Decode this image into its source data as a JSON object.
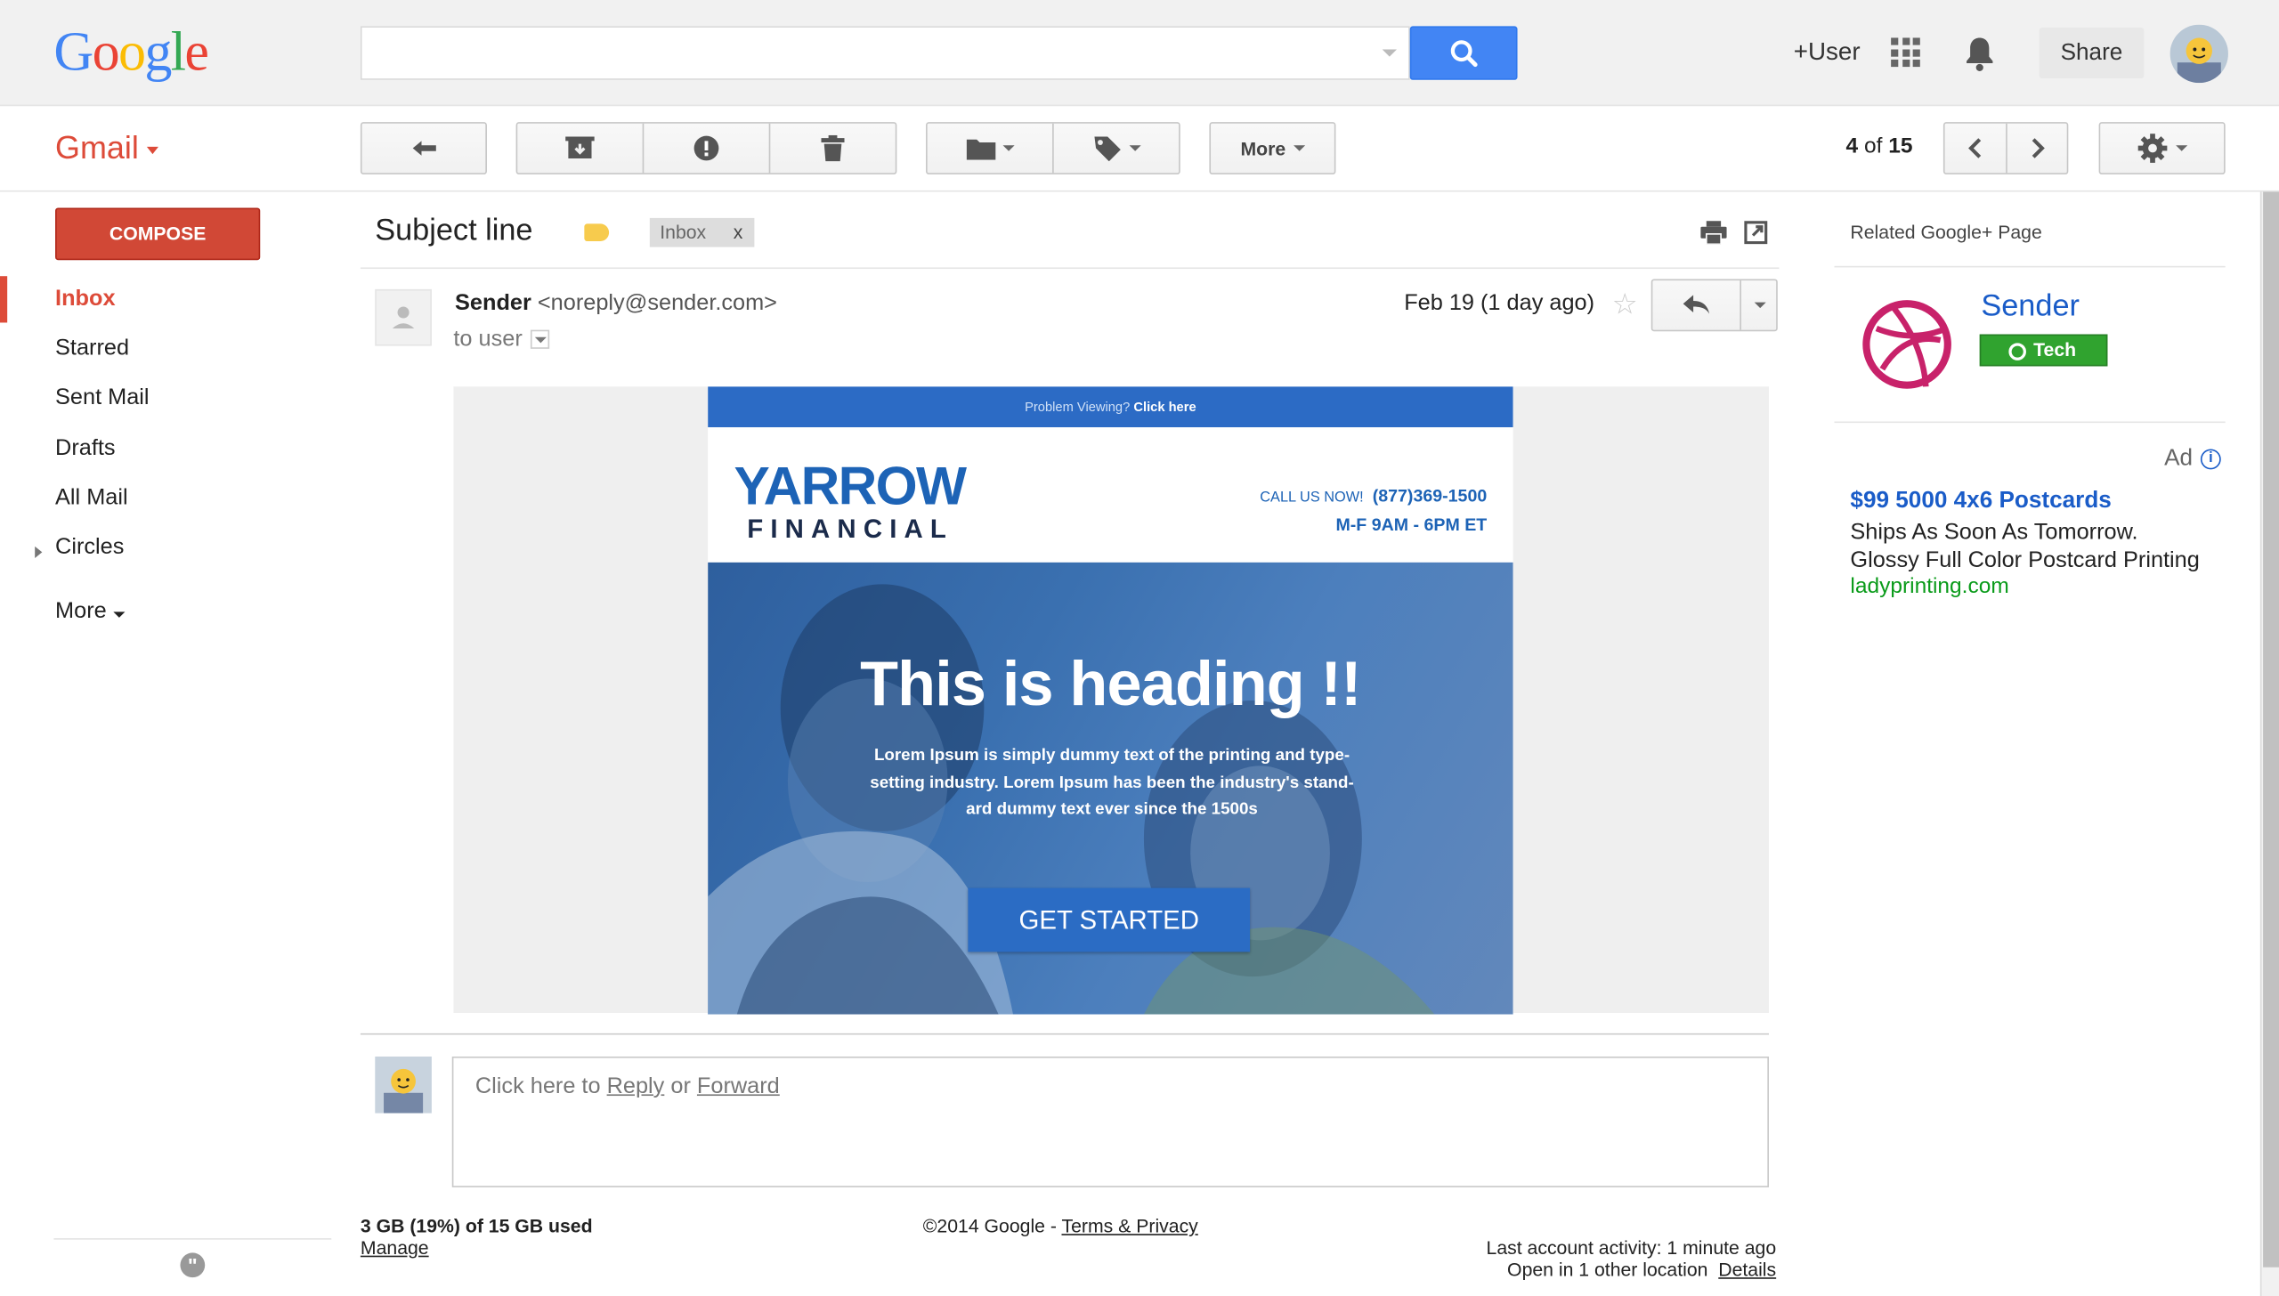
{
  "header": {
    "logo": "Google",
    "plus_user": "+User",
    "share": "Share"
  },
  "toolbar": {
    "app_name": "Gmail",
    "more": "More",
    "pager_current": "4",
    "pager_of": "of",
    "pager_total": "15"
  },
  "sidebar": {
    "compose": "COMPOSE",
    "items": [
      "Inbox",
      "Starred",
      "Sent Mail",
      "Drafts",
      "All Mail",
      "Circles"
    ],
    "more": "More"
  },
  "message": {
    "subject": "Subject line",
    "label": "Inbox",
    "label_remove": "x",
    "sender_name": "Sender",
    "sender_email": "<noreply@sender.com>",
    "to": "to user",
    "date": "Feb 19 (1 day ago)"
  },
  "email_body": {
    "problem_viewing": "Problem Viewing?",
    "click_here": "Click here",
    "brand_top": "YARROW",
    "brand_bottom": "FINANCIAL",
    "call_us": "CALL US NOW!",
    "phone": "(877)369-1500",
    "hours": "M-F 9AM - 6PM ET",
    "heading": "This is heading !!",
    "body": "Lorem Ipsum is simply dummy text of the printing and type-setting industry. Lorem Ipsum has been the industry's stand-ard dummy text ever since the 1500s",
    "cta": "GET STARTED"
  },
  "reply": {
    "prefix": "Click here to",
    "reply": "Reply",
    "or": "or",
    "forward": "Forward"
  },
  "footer": {
    "storage": "3 GB (19%) of 15 GB used",
    "manage": "Manage",
    "copyright": "©2014 Google -",
    "terms": "Terms & Privacy",
    "activity": "Last account activity: 1 minute ago",
    "open_in": "Open in 1 other location",
    "details": "Details"
  },
  "right_panel": {
    "related_title": "Related Google+ Page",
    "page_name": "Sender",
    "page_tag": "Tech",
    "ad_label": "Ad",
    "ad_info": "i",
    "ad_title": "$99 5000 4x6 Postcards",
    "ad_line1": "Ships As Soon As Tomorrow.",
    "ad_line2": "Glossy Full Color Postcard Printing",
    "ad_url": "ladyprinting.com"
  },
  "colors": {
    "gmail_red": "#dd4b39",
    "search_blue": "#4285f4",
    "email_blue": "#2c6bc5",
    "tag_green": "#30a32f",
    "link_blue": "#1a5cc8"
  }
}
